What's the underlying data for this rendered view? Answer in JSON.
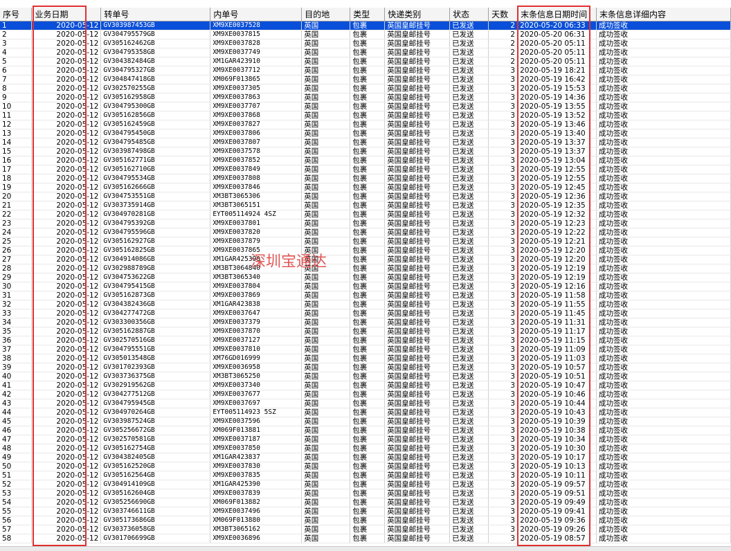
{
  "columns": [
    "序号",
    "业务日期",
    "转单号",
    "内单号",
    "目的地",
    "类型",
    "快递类别",
    "状态",
    "天数",
    "末条信息日期时间",
    "末条信息详细内容"
  ],
  "watermark": "深圳宝通达",
  "highlight_color": "#e03030",
  "selection_color": "#0a4fd9",
  "rows": [
    [
      "1",
      "2020-05-12",
      "GV303987453GB",
      "XM9XE0037528",
      "英国",
      "包裹",
      "英国皇邮挂号",
      "已发送",
      "2",
      "2020-05-20 06:33",
      "成功签收"
    ],
    [
      "2",
      "2020-05-12",
      "GV304795579GB",
      "XM9XE0037815",
      "英国",
      "包裹",
      "英国皇邮挂号",
      "已发送",
      "2",
      "2020-05-20 06:31",
      "成功签收"
    ],
    [
      "3",
      "2020-05-12",
      "GV305162462GB",
      "XM9XE0037828",
      "英国",
      "包裹",
      "英国皇邮挂号",
      "已发送",
      "2",
      "2020-05-20 05:11",
      "成功签收"
    ],
    [
      "4",
      "2020-05-12",
      "GV304795358GB",
      "XM9XE0037749",
      "英国",
      "包裹",
      "英国皇邮挂号",
      "已发送",
      "2",
      "2020-05-20 05:11",
      "成功签收"
    ],
    [
      "5",
      "2020-05-12",
      "GV304382484GB",
      "XM1GAR423910",
      "英国",
      "包裹",
      "英国皇邮挂号",
      "已发送",
      "2",
      "2020-05-20 05:11",
      "成功签收"
    ],
    [
      "6",
      "2020-05-12",
      "GV304795327GB",
      "XM9XE0037712",
      "英国",
      "包裹",
      "英国皇邮挂号",
      "已发送",
      "3",
      "2020-05-19 18:21",
      "成功签收"
    ],
    [
      "7",
      "2020-05-12",
      "GV304847418GB",
      "XM069F013865",
      "英国",
      "包裹",
      "英国皇邮挂号",
      "已发送",
      "3",
      "2020-05-19 16:42",
      "成功签收"
    ],
    [
      "8",
      "2020-05-12",
      "GV302570255GB",
      "XM9XE0037305",
      "英国",
      "包裹",
      "英国皇邮挂号",
      "已发送",
      "3",
      "2020-05-19 15:53",
      "成功签收"
    ],
    [
      "9",
      "2020-05-12",
      "GV305162958GB",
      "XM9XE0037863",
      "英国",
      "包裹",
      "英国皇邮挂号",
      "已发送",
      "3",
      "2020-05-19 14:36",
      "成功签收"
    ],
    [
      "10",
      "2020-05-12",
      "GV304795300GB",
      "XM9XE0037707",
      "英国",
      "包裹",
      "英国皇邮挂号",
      "已发送",
      "3",
      "2020-05-19 13:55",
      "成功签收"
    ],
    [
      "11",
      "2020-05-12",
      "GV305162856GB",
      "XM9XE0037868",
      "英国",
      "包裹",
      "英国皇邮挂号",
      "已发送",
      "3",
      "2020-05-19 13:52",
      "成功签收"
    ],
    [
      "12",
      "2020-05-12",
      "GV305162459GB",
      "XM9XE0037827",
      "英国",
      "包裹",
      "英国皇邮挂号",
      "已发送",
      "3",
      "2020-05-19 13:46",
      "成功签收"
    ],
    [
      "13",
      "2020-05-12",
      "GV304795450GB",
      "XM9XE0037806",
      "英国",
      "包裹",
      "英国皇邮挂号",
      "已发送",
      "3",
      "2020-05-19 13:40",
      "成功签收"
    ],
    [
      "14",
      "2020-05-12",
      "GV304795485GB",
      "XM9XE0037807",
      "英国",
      "包裹",
      "英国皇邮挂号",
      "已发送",
      "3",
      "2020-05-19 13:37",
      "成功签收"
    ],
    [
      "15",
      "2020-05-12",
      "GV303987498GB",
      "XM9XE0037578",
      "英国",
      "包裹",
      "英国皇邮挂号",
      "已发送",
      "3",
      "2020-05-19 13:37",
      "成功签收"
    ],
    [
      "16",
      "2020-05-12",
      "GV305162771GB",
      "XM9XE0037852",
      "英国",
      "包裹",
      "英国皇邮挂号",
      "已发送",
      "3",
      "2020-05-19 13:04",
      "成功签收"
    ],
    [
      "17",
      "2020-05-12",
      "GV305162710GB",
      "XM9XE0037849",
      "英国",
      "包裹",
      "英国皇邮挂号",
      "已发送",
      "3",
      "2020-05-19 12:55",
      "成功签收"
    ],
    [
      "18",
      "2020-05-12",
      "GV304795534GB",
      "XM9XE0037808",
      "英国",
      "包裹",
      "英国皇邮挂号",
      "已发送",
      "3",
      "2020-05-19 12:55",
      "成功签收"
    ],
    [
      "19",
      "2020-05-12",
      "GV305162666GB",
      "XM9XE0037846",
      "英国",
      "包裹",
      "英国皇邮挂号",
      "已发送",
      "3",
      "2020-05-19 12:45",
      "成功签收"
    ],
    [
      "20",
      "2020-05-12",
      "GV304753551GB",
      "XM3BT3065306",
      "英国",
      "包裹",
      "英国皇邮挂号",
      "已发送",
      "3",
      "2020-05-19 12:36",
      "成功签收"
    ],
    [
      "21",
      "2020-05-12",
      "GV303735914GB",
      "XM3BT3065151",
      "英国",
      "包裹",
      "英国皇邮挂号",
      "已发送",
      "3",
      "2020-05-19 12:35",
      "成功签收"
    ],
    [
      "22",
      "2020-05-12",
      "GV304970281GB",
      "EYT005114924 4SZ",
      "英国",
      "包裹",
      "英国皇邮挂号",
      "已发送",
      "3",
      "2020-05-19 12:32",
      "成功签收"
    ],
    [
      "23",
      "2020-05-12",
      "GV304795392GB",
      "XM9XE0037801",
      "英国",
      "包裹",
      "英国皇邮挂号",
      "已发送",
      "3",
      "2020-05-19 12:23",
      "成功签收"
    ],
    [
      "24",
      "2020-05-12",
      "GV304795596GB",
      "XM9XE0037820",
      "英国",
      "包裹",
      "英国皇邮挂号",
      "已发送",
      "3",
      "2020-05-19 12:22",
      "成功签收"
    ],
    [
      "25",
      "2020-05-12",
      "GV305162927GB",
      "XM9XE0037879",
      "英国",
      "包裹",
      "英国皇邮挂号",
      "已发送",
      "3",
      "2020-05-19 12:21",
      "成功签收"
    ],
    [
      "26",
      "2020-05-12",
      "GV305162825GB",
      "XM9XE0037865",
      "英国",
      "包裹",
      "英国皇邮挂号",
      "已发送",
      "3",
      "2020-05-19 12:20",
      "成功签收"
    ],
    [
      "27",
      "2020-05-12",
      "GV304914086GB",
      "XM1GAR425390",
      "英国",
      "包裹",
      "英国皇邮挂号",
      "已发送",
      "3",
      "2020-05-19 12:20",
      "成功签收"
    ],
    [
      "28",
      "2020-05-12",
      "GV302988789GB",
      "XM3BT3064840",
      "英国",
      "包裹",
      "英国皇邮挂号",
      "已发送",
      "3",
      "2020-05-19 12:19",
      "成功签收"
    ],
    [
      "29",
      "2020-05-12",
      "GV304753622GB",
      "XM3BT3065340",
      "英国",
      "包裹",
      "英国皇邮挂号",
      "已发送",
      "3",
      "2020-05-19 12:19",
      "成功签收"
    ],
    [
      "30",
      "2020-05-12",
      "GV304795415GB",
      "XM9XE0037804",
      "英国",
      "包裹",
      "英国皇邮挂号",
      "已发送",
      "3",
      "2020-05-19 12:16",
      "成功签收"
    ],
    [
      "31",
      "2020-05-12",
      "GV305162873GB",
      "XM9XE0037869",
      "英国",
      "包裹",
      "英国皇邮挂号",
      "已发送",
      "3",
      "2020-05-19 11:58",
      "成功签收"
    ],
    [
      "32",
      "2020-05-12",
      "GV304382436GB",
      "XM1GAR423838",
      "英国",
      "包裹",
      "英国皇邮挂号",
      "已发送",
      "3",
      "2020-05-19 11:55",
      "成功签收"
    ],
    [
      "33",
      "2020-05-12",
      "GV304277472GB",
      "XM9XE0037647",
      "英国",
      "包裹",
      "英国皇邮挂号",
      "已发送",
      "3",
      "2020-05-19 11:45",
      "成功签收"
    ],
    [
      "34",
      "2020-05-12",
      "GV303300356GB",
      "XM9XE0037379",
      "英国",
      "包裹",
      "英国皇邮挂号",
      "已发送",
      "3",
      "2020-05-19 11:31",
      "成功签收"
    ],
    [
      "35",
      "2020-05-12",
      "GV305162887GB",
      "XM9XE0037870",
      "英国",
      "包裹",
      "英国皇邮挂号",
      "已发送",
      "3",
      "2020-05-19 11:17",
      "成功签收"
    ],
    [
      "36",
      "2020-05-12",
      "GV302570516GB",
      "XM9XE0037127",
      "英国",
      "包裹",
      "英国皇邮挂号",
      "已发送",
      "3",
      "2020-05-19 11:15",
      "成功签收"
    ],
    [
      "37",
      "2020-05-12",
      "GV304795551GB",
      "XM9XE0037810",
      "英国",
      "包裹",
      "英国皇邮挂号",
      "已发送",
      "3",
      "2020-05-19 11:09",
      "成功签收"
    ],
    [
      "38",
      "2020-05-12",
      "GV305013548GB",
      "XM76GD016999",
      "英国",
      "包裹",
      "英国皇邮挂号",
      "已发送",
      "3",
      "2020-05-19 11:03",
      "成功签收"
    ],
    [
      "39",
      "2020-05-12",
      "GV301702393GB",
      "XM9XE0036958",
      "英国",
      "包裹",
      "英国皇邮挂号",
      "已发送",
      "3",
      "2020-05-19 10:57",
      "成功签收"
    ],
    [
      "40",
      "2020-05-12",
      "GV303736375GB",
      "XM3BT3065250",
      "英国",
      "包裹",
      "英国皇邮挂号",
      "已发送",
      "3",
      "2020-05-19 10:51",
      "成功签收"
    ],
    [
      "41",
      "2020-05-12",
      "GV302919562GB",
      "XM9XE0037340",
      "英国",
      "包裹",
      "英国皇邮挂号",
      "已发送",
      "3",
      "2020-05-19 10:47",
      "成功签收"
    ],
    [
      "42",
      "2020-05-12",
      "GV304277512GB",
      "XM9XE0037677",
      "英国",
      "包裹",
      "英国皇邮挂号",
      "已发送",
      "3",
      "2020-05-19 10:46",
      "成功签收"
    ],
    [
      "43",
      "2020-05-12",
      "GV304795945GB",
      "XM9XE0037697",
      "英国",
      "包裹",
      "英国皇邮挂号",
      "已发送",
      "3",
      "2020-05-19 10:44",
      "成功签收"
    ],
    [
      "44",
      "2020-05-12",
      "GV304970264GB",
      "EYT005114923 5SZ",
      "英国",
      "包裹",
      "英国皇邮挂号",
      "已发送",
      "3",
      "2020-05-19 10:43",
      "成功签收"
    ],
    [
      "45",
      "2020-05-12",
      "GV303987524GB",
      "XM9XE0037596",
      "英国",
      "包裹",
      "英国皇邮挂号",
      "已发送",
      "3",
      "2020-05-19 10:39",
      "成功签收"
    ],
    [
      "46",
      "2020-05-12",
      "GV305256672GB",
      "XM069F013881",
      "英国",
      "包裹",
      "英国皇邮挂号",
      "已发送",
      "3",
      "2020-05-19 10:38",
      "成功签收"
    ],
    [
      "47",
      "2020-05-12",
      "GV302570581GB",
      "XM9XE0037187",
      "英国",
      "包裹",
      "英国皇邮挂号",
      "已发送",
      "3",
      "2020-05-19 10:34",
      "成功签收"
    ],
    [
      "48",
      "2020-05-12",
      "GV305162754GB",
      "XM9XE0037850",
      "英国",
      "包裹",
      "英国皇邮挂号",
      "已发送",
      "3",
      "2020-05-19 10:30",
      "成功签收"
    ],
    [
      "49",
      "2020-05-12",
      "GV304382405GB",
      "XM1GAR423837",
      "英国",
      "包裹",
      "英国皇邮挂号",
      "已发送",
      "3",
      "2020-05-19 10:17",
      "成功签收"
    ],
    [
      "50",
      "2020-05-12",
      "GV305162520GB",
      "XM9XE0037830",
      "英国",
      "包裹",
      "英国皇邮挂号",
      "已发送",
      "3",
      "2020-05-19 10:13",
      "成功签收"
    ],
    [
      "51",
      "2020-05-12",
      "GV305162564GB",
      "XM9XE0037835",
      "英国",
      "包裹",
      "英国皇邮挂号",
      "已发送",
      "3",
      "2020-05-19 10:11",
      "成功签收"
    ],
    [
      "52",
      "2020-05-12",
      "GV304914109GB",
      "XM1GAR425390",
      "英国",
      "包裹",
      "英国皇邮挂号",
      "已发送",
      "3",
      "2020-05-19 09:57",
      "成功签收"
    ],
    [
      "53",
      "2020-05-12",
      "GV305162604GB",
      "XM9XE0037839",
      "英国",
      "包裹",
      "英国皇邮挂号",
      "已发送",
      "3",
      "2020-05-19 09:51",
      "成功签收"
    ],
    [
      "54",
      "2020-05-12",
      "GV305256690GB",
      "XM069F013882",
      "英国",
      "包裹",
      "英国皇邮挂号",
      "已发送",
      "3",
      "2020-05-19 09:49",
      "成功签收"
    ],
    [
      "55",
      "2020-05-12",
      "GV303746611GB",
      "XM9XE0037496",
      "英国",
      "包裹",
      "英国皇邮挂号",
      "已发送",
      "3",
      "2020-05-19 09:41",
      "成功签收"
    ],
    [
      "56",
      "2020-05-12",
      "GV305173686GB",
      "XM069F013880",
      "英国",
      "包裹",
      "英国皇邮挂号",
      "已发送",
      "3",
      "2020-05-19 09:36",
      "成功签收"
    ],
    [
      "57",
      "2020-05-12",
      "GV303736058GB",
      "XM3BT3065162",
      "英国",
      "包裹",
      "英国皇邮挂号",
      "已发送",
      "3",
      "2020-05-19 09:26",
      "成功签收"
    ],
    [
      "58",
      "2020-05-12",
      "GV301706699GB",
      "XM9XE0036896",
      "英国",
      "包裹",
      "英国皇邮挂号",
      "已发送",
      "3",
      "2020-05-19 08:57",
      "成功签收"
    ]
  ]
}
